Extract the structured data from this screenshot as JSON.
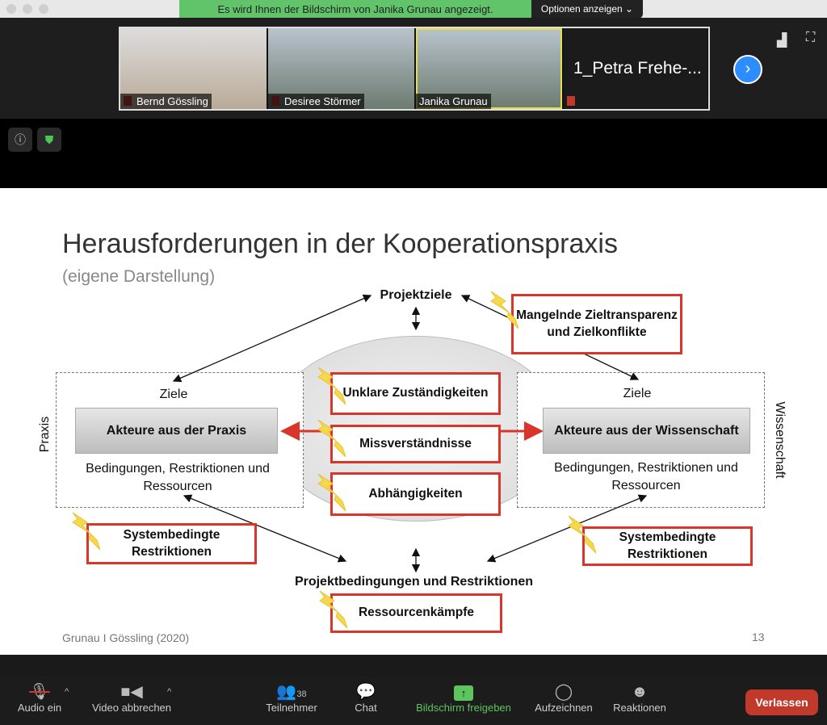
{
  "banner": {
    "text": "Es wird Ihnen der Bildschirm von Janika Grunau angezeigt.",
    "options": "Optionen anzeigen"
  },
  "participants": [
    {
      "name": "Bernd Gössling"
    },
    {
      "name": "Desiree Störmer"
    },
    {
      "name": "Janika Grunau"
    },
    {
      "name": "1_Petra Frehe-..."
    }
  ],
  "slide": {
    "title": "Herausforderungen in der Kooperationspraxis",
    "subtitle": "(eigene Darstellung)",
    "projektziele": "Projektziele",
    "ziele_left": "Ziele",
    "ziele_right": "Ziele",
    "akteure_praxis": "Akteure aus der Praxis",
    "akteure_wissenschaft": "Akteure aus der Wissenschaft",
    "bedingungen_left": "Bedingungen, Restriktionen und Ressourcen",
    "bedingungen_right": "Bedingungen, Restriktionen und Ressourcen",
    "praxis": "Praxis",
    "wissenschaft": "Wissenschaft",
    "projektbedingungen": "Projektbedingungen und Restriktionen",
    "challenges": {
      "mangelnde": "Mangelnde Zieltransparenz und Zielkonflikte",
      "unklare": "Unklare Zuständigkeiten",
      "missverstaendnisse": "Missverständnisse",
      "abhaengigkeiten": "Abhängigkeiten",
      "system_left": "Systembedingte Restriktionen",
      "system_right": "Systembedingte Restriktionen",
      "ressourcen": "Ressourcenkämpfe"
    },
    "footer": "Grunau I Gössling (2020)",
    "page": "13"
  },
  "toolbar": {
    "audio": "Audio ein",
    "video": "Video abbrechen",
    "participants": "Teilnehmer",
    "participant_count": "38",
    "chat": "Chat",
    "share": "Bildschirm freigeben",
    "record": "Aufzeichnen",
    "reactions": "Reaktionen",
    "leave": "Verlassen"
  },
  "colors": {
    "banner": "#62c46a",
    "accent": "#2d8cff",
    "leave": "#c0392b",
    "challenge_border": "#d9352b",
    "share": "#5ec45e"
  }
}
